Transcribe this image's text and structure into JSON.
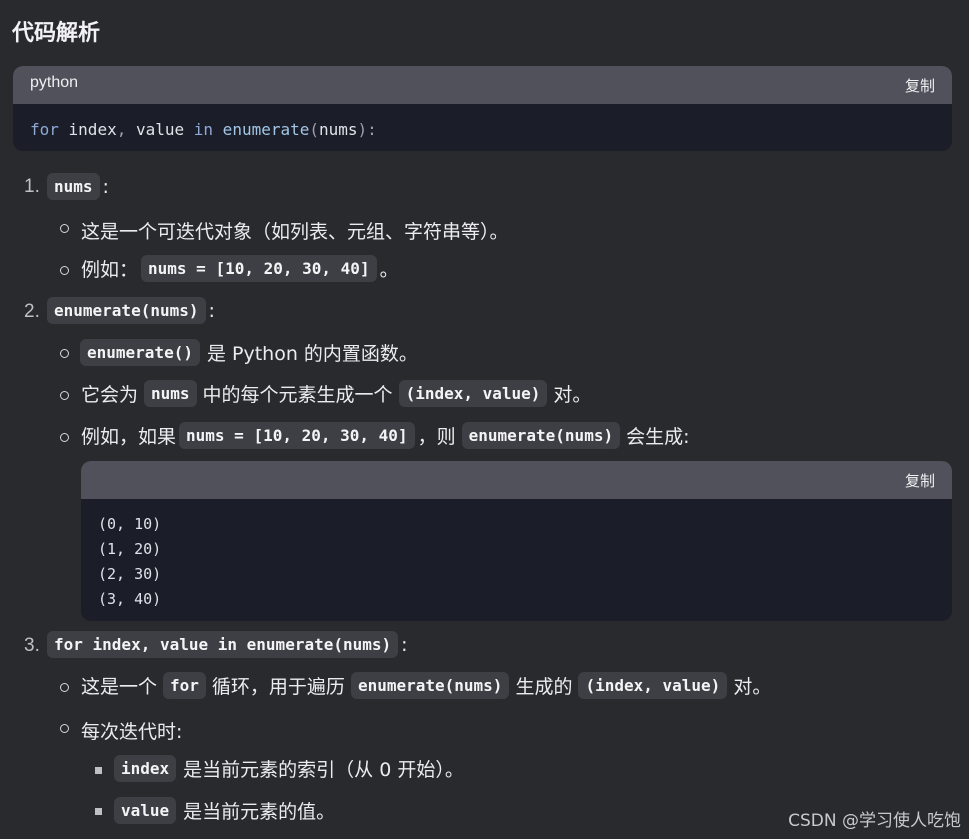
{
  "heading": "代码解析",
  "code1": {
    "lang": "python",
    "copy": "复制",
    "tokens": {
      "for": "for",
      "index": " index",
      "comma": ",",
      "value": " value ",
      "in": "in",
      "enumerate": " enumerate",
      "lp": "(",
      "nums": "nums",
      "rp": "):"
    }
  },
  "items": {
    "i1": {
      "num": "1.",
      "code": "nums",
      "colon": ":",
      "b1": "这是一个可迭代对象（如列表、元组、字符串等）。",
      "b2_pre": "例如：",
      "b2_code": "nums = [10, 20, 30, 40]",
      "b2_post": "。"
    },
    "i2": {
      "num": "2.",
      "code": "enumerate(nums)",
      "colon": ":",
      "b1_code": "enumerate()",
      "b1_text": "是 Python 的内置函数。",
      "b2_pre": "它会为",
      "b2_code1": "nums",
      "b2_mid": "中的每个元素生成一个",
      "b2_code2": "(index, value)",
      "b2_post": "对。",
      "b3_pre": "例如，如果",
      "b3_code1": "nums = [10, 20, 30, 40]",
      "b3_mid": "，则",
      "b3_code2": "enumerate(nums)",
      "b3_post": "会生成:"
    },
    "code2": {
      "copy": "复制",
      "lines": [
        "(0, 10)",
        "(1, 20)",
        "(2, 30)",
        "(3, 40)"
      ]
    },
    "i3": {
      "num": "3.",
      "code": "for index, value in enumerate(nums)",
      "colon": ":",
      "b1_pre": "这是一个",
      "b1_code1": "for",
      "b1_mid": "循环，用于遍历",
      "b1_code2": "enumerate(nums)",
      "b1_mid2": "生成的",
      "b1_code3": "(index, value)",
      "b1_post": "对。",
      "b2": "每次迭代时:",
      "s1_code": "index",
      "s1_text": "是当前元素的索引（从 0 开始）。",
      "s2_code": "value",
      "s2_text": "是当前元素的值。"
    }
  },
  "watermark": "CSDN @学习使人吃饱"
}
